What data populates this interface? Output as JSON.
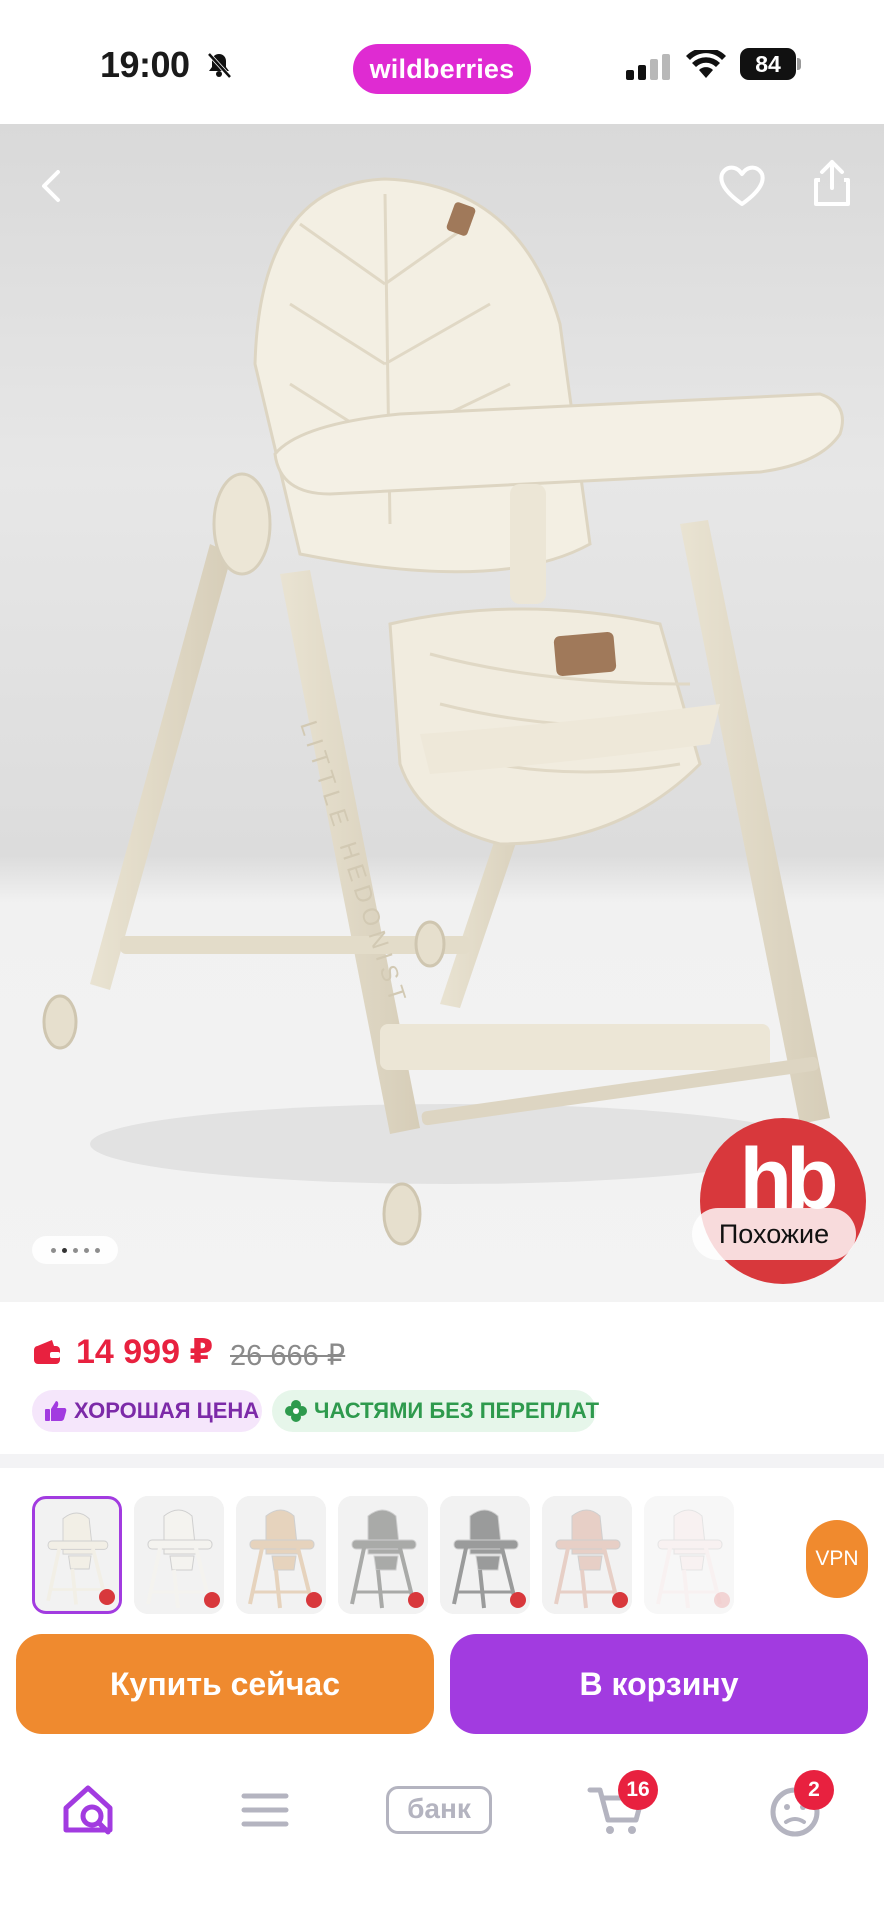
{
  "status_bar": {
    "time": "19:00",
    "brand": "wildberries",
    "battery": "84",
    "icons": [
      "bell-slash-icon",
      "cellular-signal-icon",
      "wifi-icon",
      "battery-icon"
    ]
  },
  "gallery": {
    "image_count": 5,
    "active_index": 1,
    "chair_brand_text": "LITTLE HEDONIST",
    "logo_text": "hb",
    "similar_label": "Похожие",
    "icons": [
      "back-icon",
      "heart-icon",
      "share-icon"
    ]
  },
  "pricing": {
    "price": "14 999 ₽",
    "old_price": "26 666 ₽",
    "badges": [
      {
        "label": "ХОРОШАЯ ЦЕНА",
        "icon": "thumbs-up-icon"
      },
      {
        "label": "ЧАСТЯМИ БЕЗ ПЕРЕПЛАТ",
        "icon": "clover-icon"
      }
    ]
  },
  "variants": {
    "items": [
      {
        "color": "#f2efe6",
        "selected": true
      },
      {
        "color": "#f4f3ef",
        "selected": false
      },
      {
        "color": "#e6d3bd",
        "selected": false
      },
      {
        "color": "#a9aaa8",
        "selected": false
      },
      {
        "color": "#9a9b9b",
        "selected": false
      },
      {
        "color": "#e7cfc6",
        "selected": false
      },
      {
        "color": "#f3e6e6",
        "selected": false
      }
    ],
    "vpn_label": "VPN"
  },
  "actions": {
    "buy_now": "Купить сейчас",
    "add_to_cart": "В корзину"
  },
  "bottom_nav": {
    "bank_label": "банк",
    "cart_count": "16",
    "profile_count": "2"
  },
  "colors": {
    "brand": "#df2bd2",
    "accent_purple": "#a23be0",
    "accent_orange": "#ef8a2f",
    "price_red": "#e8213f"
  }
}
